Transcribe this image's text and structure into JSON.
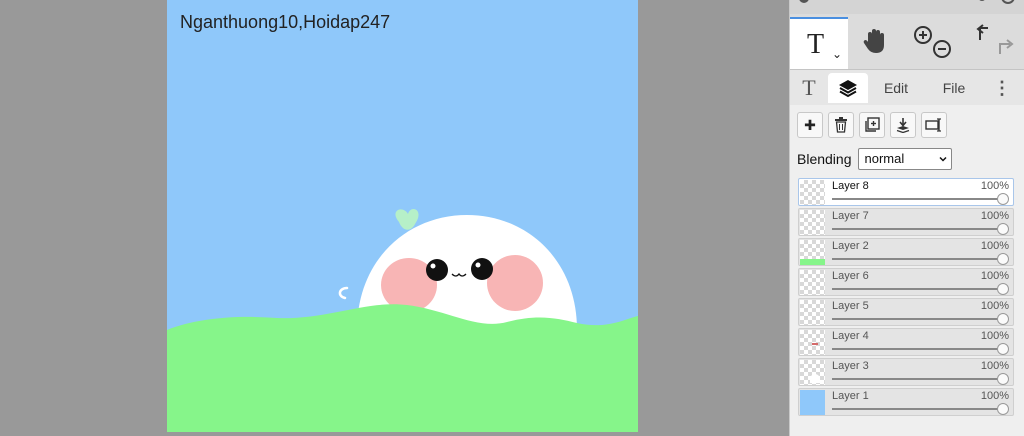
{
  "canvas": {
    "caption": "Nganthuong10,Hoidap247",
    "colors": {
      "sky": "#8fc8fa",
      "grass": "#86f58a",
      "blob": "#ffffff",
      "blush": "#f7a8a8",
      "leaf": "#b6f0c8"
    }
  },
  "toolbar": {
    "text_tool_glyph": "T",
    "text_tool_caret": "⌄",
    "icons": [
      "text-tool-icon",
      "hand-icon",
      "zoom-in-icon",
      "zoom-out-icon",
      "undo-icon",
      "redo-icon"
    ]
  },
  "tabs": {
    "text": "T",
    "edit": "Edit",
    "file": "File",
    "more": "⋮",
    "active": "layers"
  },
  "layer_actions": {
    "add": "✚",
    "icons": [
      "add-layer-icon",
      "delete-layer-icon",
      "duplicate-layer-icon",
      "merge-down-icon",
      "rename-layer-icon"
    ]
  },
  "blending": {
    "label": "Blending",
    "value": "normal"
  },
  "layers": [
    {
      "name": "Layer 8",
      "opacity": "100%",
      "selected": true,
      "thumb": "empty"
    },
    {
      "name": "Layer 7",
      "opacity": "100%",
      "selected": false,
      "thumb": "empty"
    },
    {
      "name": "Layer 2",
      "opacity": "100%",
      "selected": false,
      "thumb": "grass",
      "thumb_color": "#86f58a"
    },
    {
      "name": "Layer 6",
      "opacity": "100%",
      "selected": false,
      "thumb": "empty"
    },
    {
      "name": "Layer 5",
      "opacity": "100%",
      "selected": false,
      "thumb": "empty"
    },
    {
      "name": "Layer 4",
      "opacity": "100%",
      "selected": false,
      "thumb": "mark",
      "thumb_color": "#d46a6a"
    },
    {
      "name": "Layer 3",
      "opacity": "100%",
      "selected": false,
      "thumb": "blob",
      "thumb_color": "#ffffff"
    },
    {
      "name": "Layer 1",
      "opacity": "100%",
      "selected": false,
      "thumb": "sky",
      "thumb_color": "#8fc8fa"
    }
  ]
}
